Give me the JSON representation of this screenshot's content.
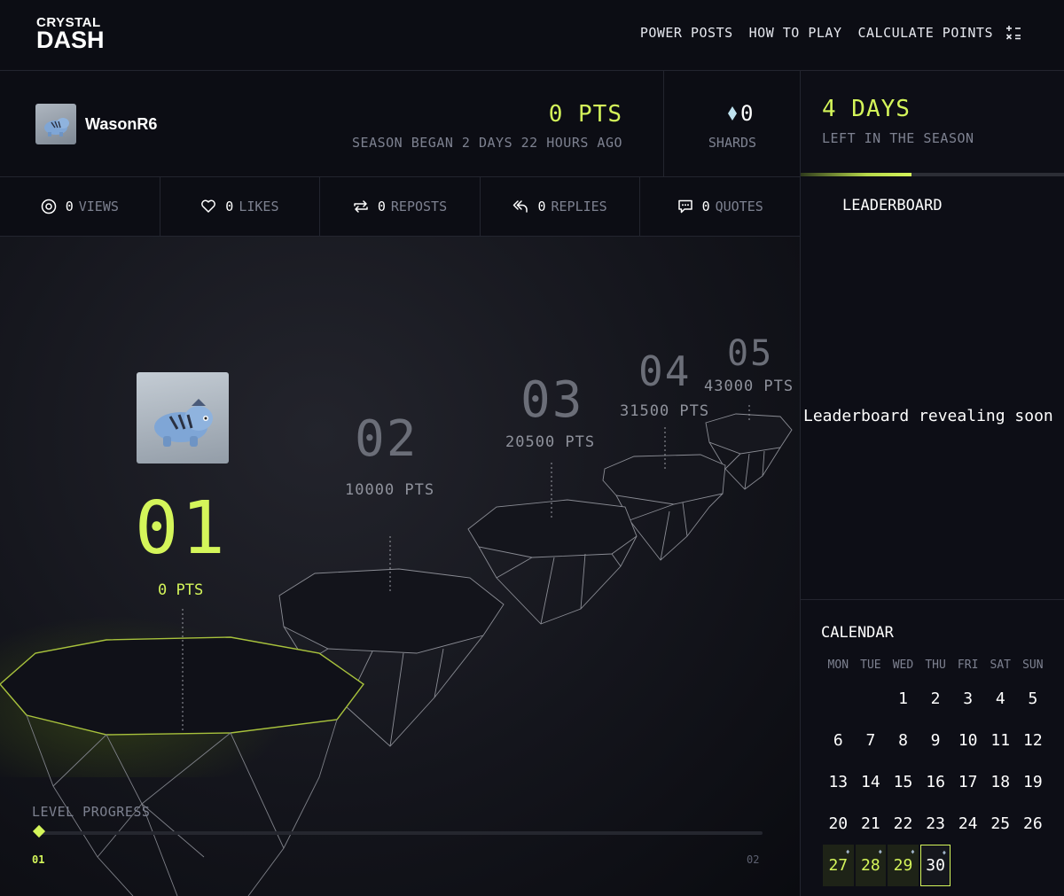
{
  "brand": {
    "line1": "CRYSTAL",
    "line2": "DASH"
  },
  "nav": {
    "items": [
      "POWER POSTS",
      "HOW TO PLAY",
      "CALCULATE POINTS"
    ],
    "calc_icon": "calculator-icon"
  },
  "profile": {
    "username": "WasonR6",
    "points": "0 PTS",
    "season_started": "SEASON BEGAN 2 DAYS 22 HOURS AGO",
    "shards_value": "0",
    "shards_label": "SHARDS"
  },
  "season": {
    "days_left": "4 DAYS",
    "days_left_sub": "LEFT IN THE SEASON",
    "progress": 0.42
  },
  "stats": [
    {
      "icon": "eye-icon",
      "value": "0",
      "label": "VIEWS"
    },
    {
      "icon": "heart-icon",
      "value": "0",
      "label": "LIKES"
    },
    {
      "icon": "repost-icon",
      "value": "0",
      "label": "REPOSTS"
    },
    {
      "icon": "reply-icon",
      "value": "0",
      "label": "REPLIES"
    },
    {
      "icon": "quote-icon",
      "value": "0",
      "label": "QUOTES"
    }
  ],
  "levels": [
    {
      "num": "01",
      "pts": "0 PTS"
    },
    {
      "num": "02",
      "pts": "10000 PTS"
    },
    {
      "num": "03",
      "pts": "20500 PTS"
    },
    {
      "num": "04",
      "pts": "31500 PTS"
    },
    {
      "num": "05",
      "pts": "43000 PTS"
    }
  ],
  "level_progress": {
    "label": "LEVEL PROGRESS",
    "start": "01",
    "end": "02",
    "value": 0
  },
  "leaderboard": {
    "title": "LEADERBOARD",
    "message": "Leaderboard revealing soon"
  },
  "calendar": {
    "title": "CALENDAR",
    "weekdays": [
      "MON",
      "TUE",
      "WED",
      "THU",
      "FRI",
      "SAT",
      "SUN"
    ],
    "leading_blanks": 2,
    "days": [
      "1",
      "2",
      "3",
      "4",
      "5",
      "6",
      "7",
      "8",
      "9",
      "10",
      "11",
      "12",
      "13",
      "14",
      "15",
      "16",
      "17",
      "18",
      "19",
      "20",
      "21",
      "22",
      "23",
      "24",
      "25",
      "26",
      "27",
      "28",
      "29",
      "30"
    ],
    "highlighted": [
      "27",
      "28",
      "29"
    ],
    "today": "30",
    "colors": {
      "accent": "#d4f55a"
    }
  }
}
